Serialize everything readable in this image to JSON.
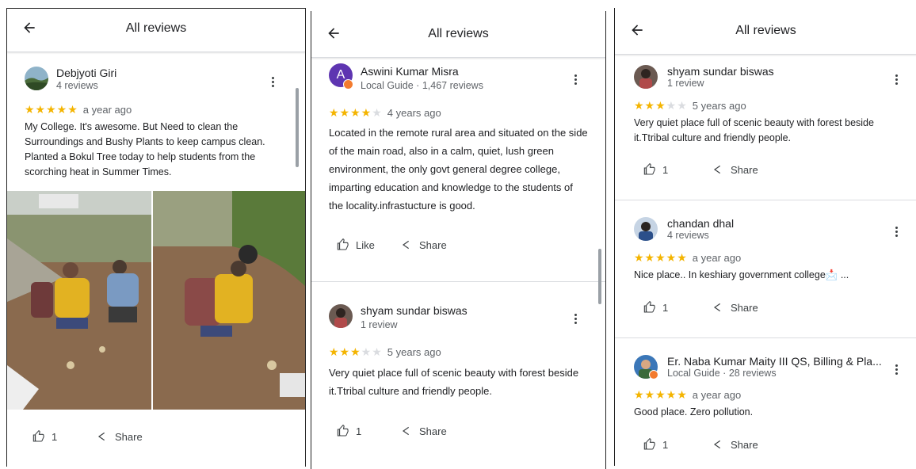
{
  "panels": [
    {
      "header": {
        "title": "All reviews"
      },
      "review": {
        "name": "Debjyoti Giri",
        "meta": "4 reviews",
        "rating": 5,
        "stars_on": "★★★★★",
        "stars_off": "",
        "date": "a year ago",
        "text_lines": [
          "My College. It's awesome. But Need to clean the",
          "Surroundings and Bushy Plants to keep campus clean.",
          "Planted a Bokul Tree today to help students from the",
          "scorching heat in Summer Times."
        ],
        "like_count": "1",
        "share_label": "Share"
      }
    },
    {
      "header": {
        "title": "All reviews"
      },
      "reviews": [
        {
          "name": "Aswini Kumar Misra",
          "meta": "Local Guide · 1,467 reviews",
          "avatar_letter": "A",
          "rating": 4,
          "stars_on": "★★★★",
          "stars_off": "★",
          "date": "4 years ago",
          "text_lines": [
            "Located in the remote rural area and situated on the side",
            "of the main road, also in a calm, quiet, lush green",
            "environment, the only govt general degree college,",
            "imparting education and knowledge to the students of",
            "the locality.infrastucture is good."
          ],
          "like_label": "Like",
          "share_label": "Share"
        },
        {
          "name": "shyam sundar biswas",
          "meta": "1 review",
          "rating": 3,
          "stars_on": "★★★",
          "stars_off": "★★",
          "date": "5 years ago",
          "text_lines": [
            "Very quiet place full of scenic beauty with forest beside",
            "it.Ttribal culture and friendly people."
          ],
          "like_count": "1",
          "share_label": "Share"
        }
      ]
    },
    {
      "header": {
        "title": "All reviews"
      },
      "reviews": [
        {
          "name": "shyam sundar biswas",
          "meta": "1 review",
          "rating": 3,
          "stars_on": "★★★",
          "stars_off": "★★",
          "date": "5 years ago",
          "text_lines": [
            "Very quiet place full of scenic beauty with forest beside",
            "it.Ttribal culture and friendly people."
          ],
          "like_count": "1",
          "share_label": "Share"
        },
        {
          "name": "chandan dhal",
          "meta": "4 reviews",
          "rating": 5,
          "stars_on": "★★★★★",
          "stars_off": "",
          "date": "a year ago",
          "text_lines": [
            "Nice place.. In keshiary government college📩 ..."
          ],
          "like_count": "1",
          "share_label": "Share"
        },
        {
          "name": "Er. Naba Kumar Maity III QS, Billing & Pla...",
          "meta": "Local Guide · 28 reviews",
          "rating": 5,
          "stars_on": "★★★★★",
          "stars_off": "",
          "date": "a year ago",
          "text_lines": [
            "Good place. Zero pollution."
          ],
          "like_count": "1",
          "share_label": "Share"
        }
      ]
    }
  ],
  "colors": {
    "star": "#f4b400",
    "star_off": "#dadce0",
    "divider": "#dadce0",
    "guide_badge": "#f37b2e",
    "avatar_purple": "#5e35b1"
  },
  "icons": [
    "back-arrow-icon",
    "more-vert-icon",
    "thumb-up-icon",
    "share-icon",
    "local-guide-badge-icon"
  ]
}
